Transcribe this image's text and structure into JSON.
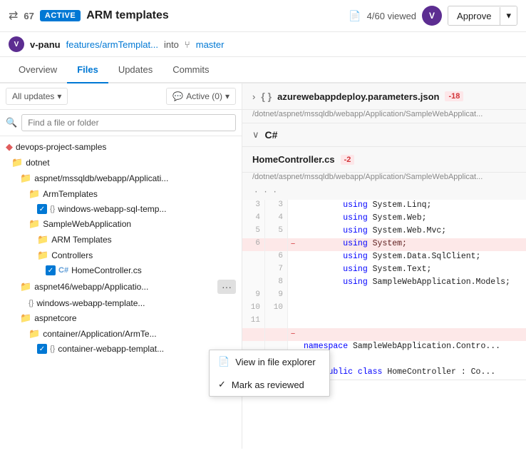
{
  "header": {
    "pr_icon": "⇄",
    "pr_number": "67",
    "active_badge": "ACTIVE",
    "pr_title": "ARM templates",
    "viewed_label": "4/60 viewed",
    "approve_label": "Approve"
  },
  "author_bar": {
    "author": "v-panu",
    "branch_from": "features/armTemplat...",
    "into_label": "into",
    "branch_to": "master"
  },
  "tabs": [
    {
      "label": "Overview",
      "active": false
    },
    {
      "label": "Files",
      "active": true
    },
    {
      "label": "Updates",
      "active": false
    },
    {
      "label": "Commits",
      "active": false
    }
  ],
  "filter": {
    "all_updates_label": "All updates",
    "active_count_label": "Active (0)"
  },
  "search": {
    "placeholder": "Find a file or folder"
  },
  "file_tree": [
    {
      "id": "root",
      "label": "devops-project-samples",
      "indent": 0,
      "type": "root"
    },
    {
      "id": "dotnet",
      "label": "dotnet",
      "indent": 1,
      "type": "folder"
    },
    {
      "id": "aspnet",
      "label": "aspnet/mssqldb/webapp/Applicati...",
      "indent": 2,
      "type": "folder"
    },
    {
      "id": "armtemplates",
      "label": "ArmTemplates",
      "indent": 3,
      "type": "folder"
    },
    {
      "id": "windows-sql",
      "label": "windows-webapp-sql-temp...",
      "indent": 4,
      "type": "json",
      "checked": true
    },
    {
      "id": "samplewebapp",
      "label": "SampleWebApplication",
      "indent": 3,
      "type": "folder"
    },
    {
      "id": "arm-templates2",
      "label": "ARM Templates",
      "indent": 4,
      "type": "folder"
    },
    {
      "id": "controllers",
      "label": "Controllers",
      "indent": 4,
      "type": "folder"
    },
    {
      "id": "homecontroller",
      "label": "HomeController.cs",
      "indent": 5,
      "type": "cs",
      "checked": true
    },
    {
      "id": "aspnet46",
      "label": "aspnet46/webapp/Applicatio...",
      "indent": 2,
      "type": "folder",
      "hasDots": true
    },
    {
      "id": "windows-webapp-template",
      "label": "windows-webapp-template...",
      "indent": 3,
      "type": "json"
    },
    {
      "id": "aspnetcore",
      "label": "aspnetcore",
      "indent": 2,
      "type": "folder"
    },
    {
      "id": "container-app",
      "label": "container/Application/ArmTe...",
      "indent": 3,
      "type": "folder"
    },
    {
      "id": "container-webapp",
      "label": "container-webapp-templat...",
      "indent": 4,
      "type": "json",
      "checked": true
    }
  ],
  "context_menu": {
    "items": [
      {
        "label": "View in file explorer",
        "icon": "file",
        "checked": false
      },
      {
        "label": "Mark as reviewed",
        "icon": "check",
        "checked": true
      }
    ]
  },
  "right_panel": {
    "file1": {
      "name": "azurewebappdeploy.parameters.json",
      "change": "-18",
      "path": "/dotnet/aspnet/mssqldb/webapp/Application/SampleWebApplicat...",
      "collapsed": true,
      "collapse_icon": "›"
    },
    "file2": {
      "name": "HomeController.cs",
      "change": "-2",
      "path": "/dotnet/aspnet/mssqldb/webapp/Application/SampleWebApplicat...",
      "lang": "C#",
      "collapse_icon": "∨"
    },
    "code_rows": [
      {
        "old": "",
        "new": "",
        "marker": "",
        "content": "...",
        "type": "dots"
      },
      {
        "old": "3",
        "new": "3",
        "marker": "",
        "content": "            using System.Linq;",
        "type": "normal"
      },
      {
        "old": "4",
        "new": "4",
        "marker": "",
        "content": "            using System.Web;",
        "type": "normal"
      },
      {
        "old": "5",
        "new": "5",
        "marker": "",
        "content": "            using System.Web.Mvc;",
        "type": "normal"
      },
      {
        "old": "6",
        "new": "",
        "marker": "-",
        "content": "            using System;",
        "type": "deleted"
      },
      {
        "old": "",
        "new": "6",
        "marker": "",
        "content": "            using System.Data.SqlClient;",
        "type": "normal"
      },
      {
        "old": "",
        "new": "7",
        "marker": "",
        "content": "            using System.Text;",
        "type": "normal"
      },
      {
        "old": "",
        "new": "8",
        "marker": "",
        "content": "            using SampleWebApplication.Models;",
        "type": "normal"
      },
      {
        "old": "9",
        "new": "9",
        "marker": "",
        "content": "",
        "type": "normal"
      },
      {
        "old": "10",
        "new": "10",
        "marker": "",
        "content": "",
        "type": "normal"
      },
      {
        "old": "11",
        "new": "",
        "marker": "",
        "content": "",
        "type": "normal"
      },
      {
        "old": "",
        "new": "",
        "marker": "-",
        "content": "",
        "type": "deleted2"
      },
      {
        "old": "",
        "new": "",
        "marker": "",
        "content": "namespace SampleWebApplication.Contro...",
        "type": "normal2"
      },
      {
        "old": "",
        "new": "",
        "marker": "",
        "content": "{",
        "type": "normal2"
      },
      {
        "old": "",
        "new": "",
        "marker": "",
        "content": "    public class HomeController : Co...",
        "type": "normal2"
      }
    ]
  }
}
